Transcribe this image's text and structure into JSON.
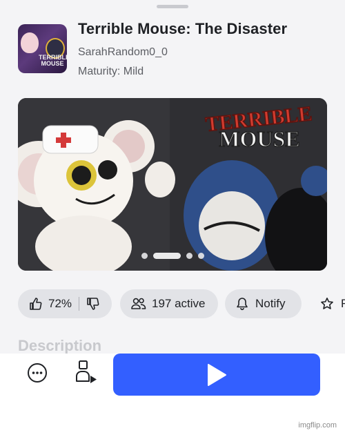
{
  "game": {
    "title": "Terrible Mouse: The Disaster",
    "creator": "SarahRandom0_0",
    "maturity": "Maturity: Mild",
    "thumbnail_logo": "TERRIBLE MOUSE"
  },
  "banner": {
    "logo_text": "TERRIBLE MOUSE",
    "carousel_count": 4,
    "carousel_active_index": 1
  },
  "stats": {
    "rating": "72%",
    "active": "197 active",
    "notify": "Notify",
    "favorite_partial": "F"
  },
  "description": {
    "heading": "Description"
  },
  "watermark": "imgflip.com",
  "icons": [
    "thumbs-up-icon",
    "thumbs-down-icon",
    "people-icon",
    "bell-icon",
    "star-icon",
    "more-icon",
    "avatar-play-icon",
    "play-icon"
  ],
  "colors": {
    "play_button": "#335fff",
    "pill_bg": "#e2e3e7",
    "sheet_bg": "#f4f4f6"
  }
}
